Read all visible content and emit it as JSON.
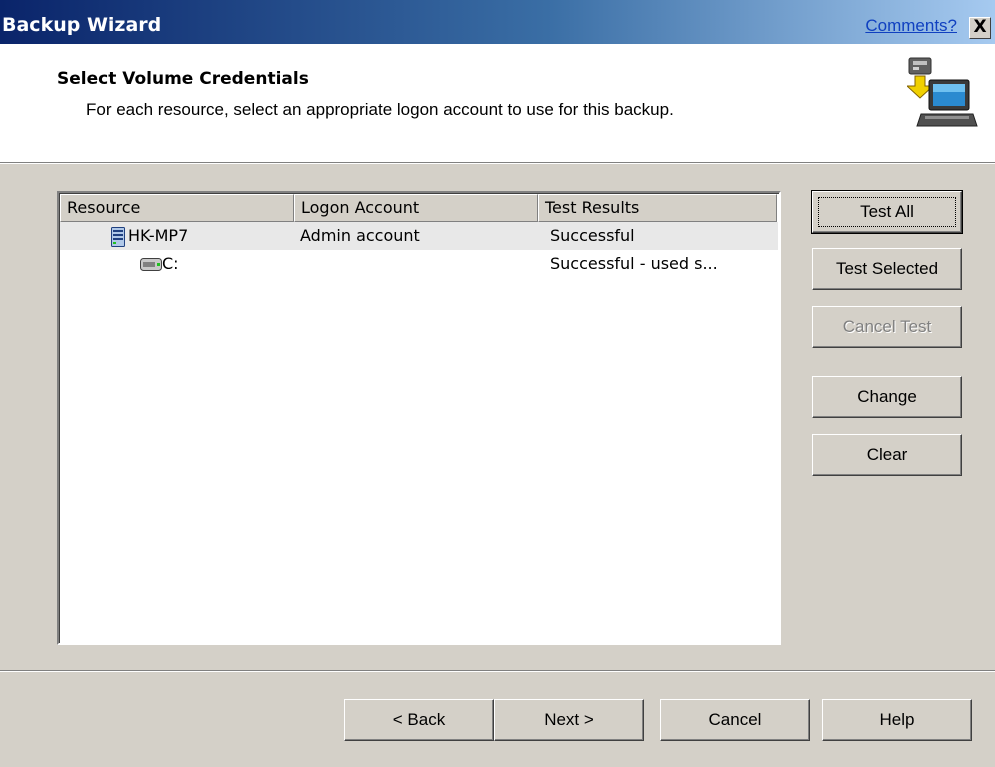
{
  "window": {
    "title": "Backup Wizard",
    "comments_link": "Comments?",
    "close_glyph": "X"
  },
  "header": {
    "title": "Select Volume Credentials",
    "subtitle": "For each resource, select an appropriate logon account to use for this backup.",
    "icon": "computer-credentials-icon"
  },
  "list": {
    "columns": [
      "Resource",
      "Logon Account",
      "Test Results"
    ],
    "rows": [
      {
        "icon": "server-icon",
        "resource": "HK-MP7",
        "logon_account": "Admin account",
        "test_results": "Successful"
      },
      {
        "icon": "drive-icon",
        "resource": "C:",
        "logon_account": "",
        "test_results": "Successful - used s..."
      }
    ]
  },
  "side_buttons": {
    "test_all": "Test All",
    "test_selected": "Test Selected",
    "cancel_test": "Cancel Test",
    "change": "Change",
    "clear": "Clear"
  },
  "footer_buttons": {
    "back": "< Back",
    "next": "Next >",
    "cancel": "Cancel",
    "help": "Help"
  },
  "colors": {
    "title_gradient_start": "#0a246a",
    "title_gradient_end": "#a6caf0",
    "face": "#d4d0c8",
    "selected_row": "#e8e8e8"
  }
}
